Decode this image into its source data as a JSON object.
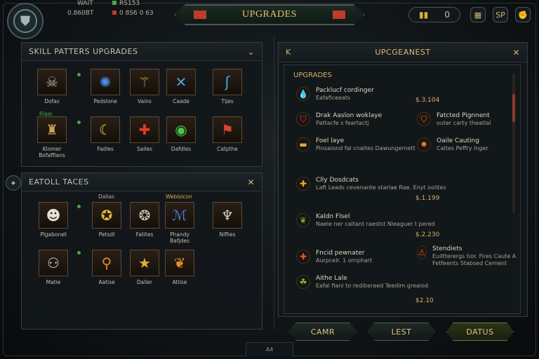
{
  "topbar": {
    "resources": [
      {
        "label": "WAIT",
        "color": "#c7c0ae"
      },
      {
        "label": "0.860BT",
        "color": "#c7c0ae"
      },
      {
        "label": "RS153",
        "color": "#4fa34a"
      },
      {
        "label": "0 8S6 0 63",
        "color": "#c2392b"
      }
    ],
    "title": "UPGRADES",
    "currency_value": "0",
    "top_icons": [
      "trophy-icon",
      "sp-icon",
      "fist-icon"
    ],
    "top_icon_glyphs": [
      "▦",
      "SP",
      "✊"
    ]
  },
  "left_panel": {
    "skill_title": "SKILL PATTERS UPGRADES",
    "skills": [
      {
        "label": "Dofas",
        "icon": "beast-skull-icon",
        "glyph": "☠",
        "color": "#b9ab93"
      },
      {
        "label": "Pedslone",
        "icon": "blue-wolf-icon",
        "glyph": "✺",
        "color": "#4a8ee6"
      },
      {
        "label": "Vains",
        "icon": "tree-rune-icon",
        "glyph": "⚚",
        "color": "#d89c3a"
      },
      {
        "label": "Caade",
        "icon": "crossed-blades-icon",
        "glyph": "✕",
        "color": "#4aa3d6"
      },
      {
        "label": "Tljes",
        "icon": "serpent-icon",
        "glyph": "ʃ",
        "color": "#4fa6d8"
      },
      {
        "label": "Klomer Bofaffians",
        "icon": "armored-warrior-icon",
        "glyph": "♜",
        "color": "#d2a24f"
      },
      {
        "label": "Fadles",
        "icon": "crescent-moon-icon",
        "glyph": "☾",
        "color": "#f0d04a"
      },
      {
        "label": "Sailes",
        "icon": "red-cross-icon",
        "glyph": "✚",
        "color": "#e03a2a"
      },
      {
        "label": "Dafdles",
        "icon": "green-eye-icon",
        "glyph": "◉",
        "color": "#49c24a"
      },
      {
        "label": "Catpthe",
        "icon": "red-banner-icon",
        "glyph": "⚑",
        "color": "#d8442e"
      }
    ],
    "skill_note": "Rlaei",
    "tactics_title": "EATOLL TACES",
    "tactics": [
      {
        "label": "Plgabonet",
        "icon": "skull-icon",
        "glyph": "☻",
        "color": "#e6e0d0"
      },
      {
        "label": "Petsdl",
        "icon": "gold-ring-icon",
        "glyph": "✪",
        "color": "#e0b63a"
      },
      {
        "label": "Fatites",
        "icon": "mandala-icon",
        "glyph": "❂",
        "color": "#d0c8b8"
      },
      {
        "label": "Phandy Bafjdes",
        "icon": "blue-rune-icon",
        "glyph": "ℳ",
        "color": "#4a7fe0"
      },
      {
        "label": "Niflles",
        "icon": "horned-mask-icon",
        "glyph": "♆",
        "color": "#d8d0c0"
      },
      {
        "label": "Matie",
        "icon": "brain-icon",
        "glyph": "⚇",
        "color": "#d8d0c0"
      },
      {
        "label": "Aatise",
        "icon": "orange-key-icon",
        "glyph": "⚲",
        "color": "#e08a2a"
      },
      {
        "label": "Dalier",
        "icon": "gold-star-icon",
        "glyph": "★",
        "color": "#e0b03a"
      },
      {
        "label": "Atilse",
        "icon": "flame-beast-icon",
        "glyph": "❦",
        "color": "#e0902a"
      }
    ],
    "tactics_note_top": "Dalias",
    "tactics_note_top2": "Webisicon"
  },
  "right_panel": {
    "header_left": "K",
    "title": "UPCGEANEST",
    "section": "UPGRADES",
    "entries": [
      {
        "title": "Packlucf cordinger",
        "sub": "Eafaficeeats",
        "icon": "flame-drop-icon",
        "glyph": "💧",
        "color": "#f0b33a"
      },
      {
        "title": "Drak Aaslon woklaye",
        "sub": "Pattacfe s feartactj",
        "icon": "red-shield-icon",
        "glyph": "⛉",
        "color": "#e0402a"
      },
      {
        "title": "Fatcted Pignnent",
        "sub": "outer carty theatlal",
        "icon": "orange-shield-icon",
        "glyph": "⛉",
        "color": "#e06a2a"
      },
      {
        "title": "Foel laye",
        "sub": "Pinsaiond fal cnaltes Dawungernett",
        "icon": "chest-icon",
        "glyph": "▬",
        "color": "#d8b04a"
      },
      {
        "title": "Oaile Cauting",
        "sub": "Caltes Peffry lnger",
        "icon": "fox-icon",
        "glyph": "✹",
        "color": "#e07a2a"
      },
      {
        "title": "Clly Dosdcats",
        "sub": "Laft Leads cevenante starlae Rae. Enyt oolites",
        "icon": "gold-cross-icon",
        "glyph": "✚",
        "color": "#e0b03a"
      },
      {
        "title": "Kaldn Flsel",
        "sub": "Naele ner caltant raestst Nleaguer t pered",
        "icon": "dragon-icon",
        "glyph": "❦",
        "color": "#6ab04a"
      },
      {
        "title": "Stendiets",
        "sub": "Euiltterergs tior. Fires Caute A Fetfeents Stabsed Cement",
        "icon": "warning-icon",
        "glyph": "⚠",
        "color": "#e05a2a"
      },
      {
        "title": "Fncid pewnater",
        "sub": "Aurpcelr. 1 ornphart",
        "icon": "orange-plus-icon",
        "glyph": "✚",
        "color": "#e05a2a"
      },
      {
        "title": "Aithe Lale",
        "sub": "Eafal fiani to rediberaed Teedim greaiod",
        "icon": "green-beast-icon",
        "glyph": "☘",
        "color": "#7ac04a"
      }
    ],
    "prices": [
      "$.3.104",
      "$.1.199",
      "$.2.230",
      "$2.10"
    ]
  },
  "buttons": [
    "CAMR",
    "LEST",
    "DATUS"
  ],
  "bottom_mark": "A4"
}
